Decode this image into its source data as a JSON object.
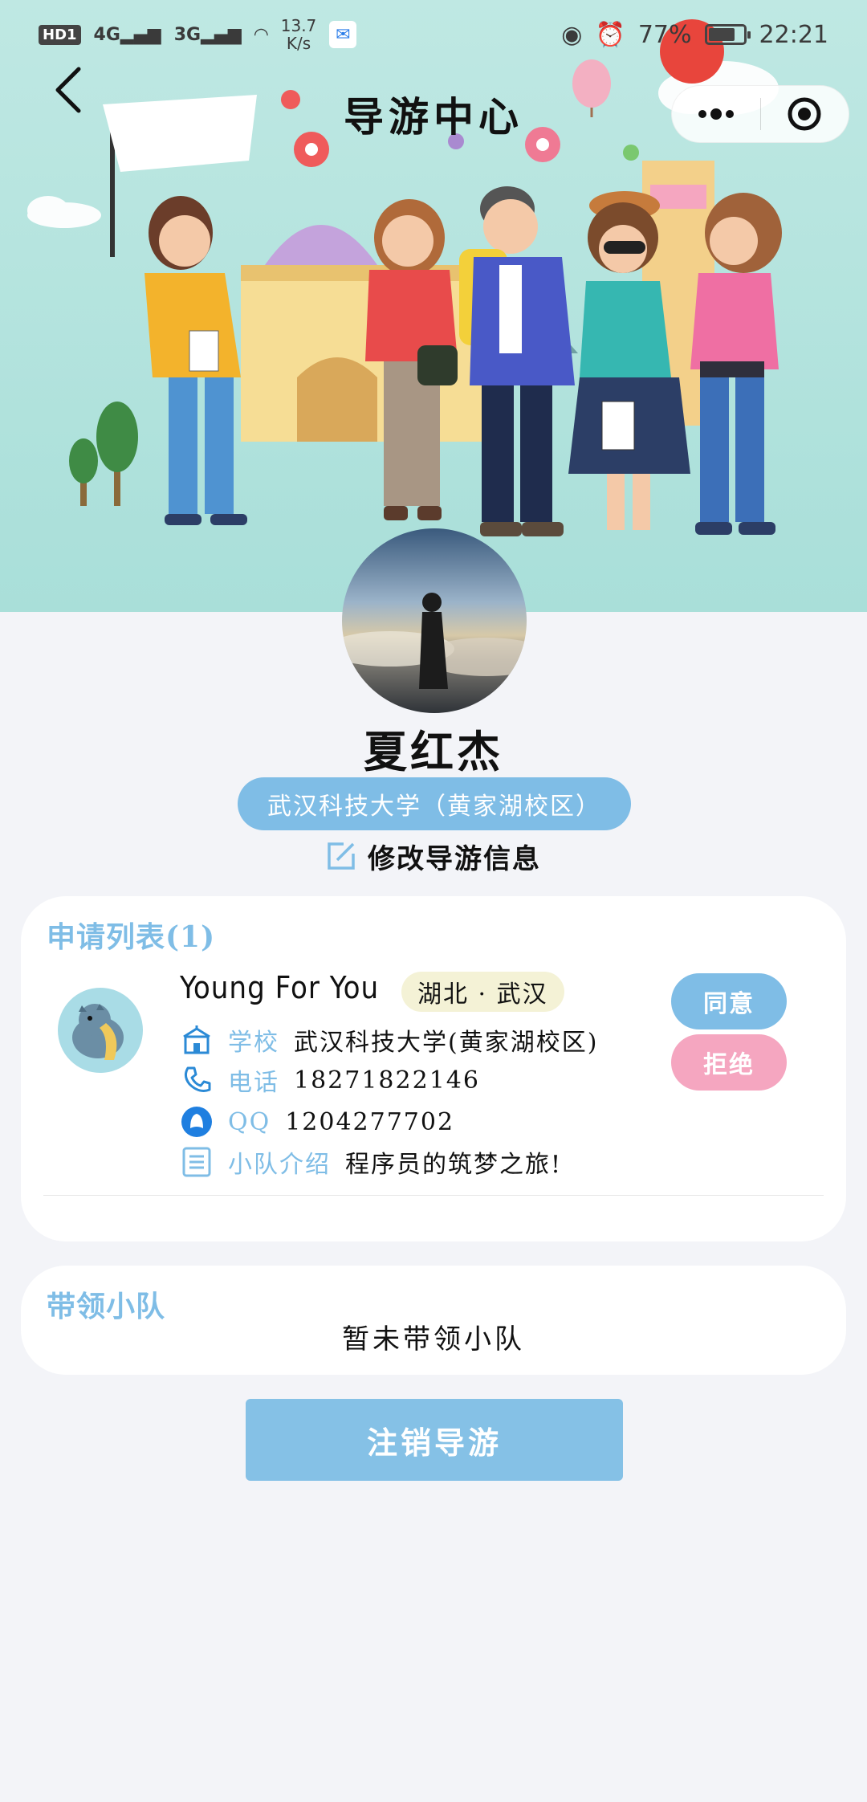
{
  "status_bar": {
    "hd": "HD",
    "sim": "1",
    "net1": "4G",
    "net2": "3G",
    "speed_value": "13.7",
    "speed_unit": "K/s",
    "battery": "77%",
    "time": "22:21"
  },
  "nav": {
    "title": "导游中心"
  },
  "profile": {
    "name": "夏红杰",
    "school": "武汉科技大学（黄家湖校区）",
    "edit_label": "修改导游信息"
  },
  "apply_list": {
    "title": "申请列表(1)",
    "items": [
      {
        "name": "Young For You",
        "region": "湖北 · 武汉",
        "school_label": "学校",
        "school_value": "武汉科技大学(黄家湖校区)",
        "phone_label": "电话",
        "phone_value": "18271822146",
        "qq_label": "QQ",
        "qq_value": "1204277702",
        "intro_label": "小队介绍",
        "intro_value": "程序员的筑梦之旅!",
        "agree_label": "同意",
        "reject_label": "拒绝"
      }
    ]
  },
  "team": {
    "title": "带领小队",
    "empty_text": "暂未带领小队"
  },
  "logout_label": "注销导游",
  "colors": {
    "accent": "#7fbde6",
    "reject": "#f5a6c0",
    "hero_bg": "#bfe8e3",
    "page_bg": "#f3f4f8"
  }
}
